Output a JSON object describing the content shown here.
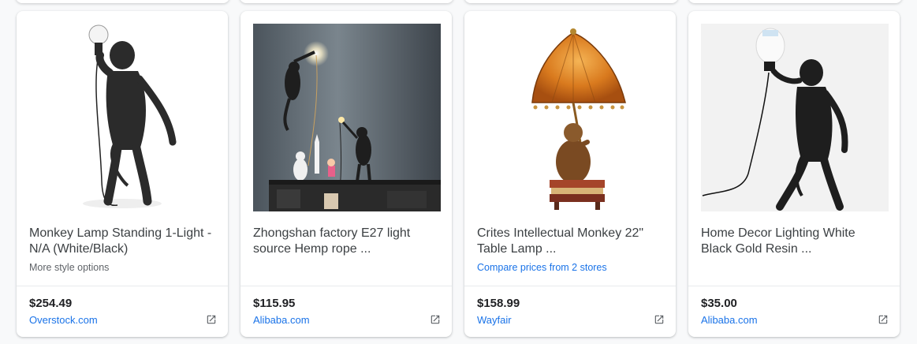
{
  "products": [
    {
      "title_lines": [
        "Monkey Lamp Standing 1-Light -",
        "N/A (White/Black)"
      ],
      "subtext": "More style options",
      "price": "$254.49",
      "store": "Overstock.com",
      "image_icon": "standing-monkey-lamp-image",
      "link_icon": "open-external-icon"
    },
    {
      "title_lines": [
        "Zhongshan factory E27 light",
        "source Hemp rope ..."
      ],
      "subtext": "",
      "price": "$115.95",
      "store": "Alibaba.com",
      "image_icon": "monkey-lamp-room-image",
      "link_icon": "open-external-icon"
    },
    {
      "title_lines": [
        "Crites Intellectual Monkey 22\"",
        "Table Lamp ..."
      ],
      "subtext": "Compare prices from 2 stores",
      "price": "$158.99",
      "store": "Wayfair",
      "image_icon": "umbrella-monkey-table-lamp-image",
      "link_icon": "open-external-icon"
    },
    {
      "title_lines": [
        "Home Decor Lighting White",
        "Black Gold Resin ..."
      ],
      "subtext": "",
      "price": "$35.00",
      "store": "Alibaba.com",
      "image_icon": "resin-monkey-lamp-image",
      "link_icon": "open-external-icon"
    }
  ],
  "colors": {
    "link": "#1a73e8",
    "title": "#3c4043",
    "price": "#202124",
    "muted": "#5f6368"
  }
}
